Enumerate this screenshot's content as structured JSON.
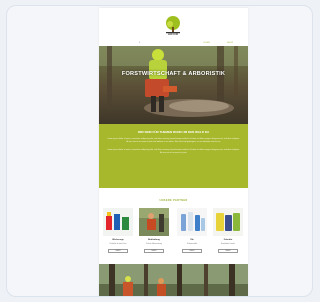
{
  "site": {
    "logo_text": "AIFOR",
    "nav_left": "≡",
    "nav_right": [
      "LOGIN",
      "SHOP"
    ]
  },
  "hero": {
    "title": "FORSTWIRTSCHAFT & ARBORISTIK"
  },
  "intro": {
    "title": "WIR SIND FÜR THEMEN RUND UM DEN WALD DA",
    "body1": "Lorem ipsum dolor sit amet, consetetur sadipscing elitr, sed diam nonumy eirmod tempor invidunt ut labore et dolore magna aliquyam erat, sed diam voluptua. At vero eos et accusam et justo duo dolores et ea rebum. Stet clita kasd gubergren, no sea takimata sanctus est.",
    "body2": "Lorem ipsum dolor sit amet, consetetur sadipscing elitr, sed diam nonumy eirmod tempor invidunt ut labore et dolore magna aliquyam erat, sed diam voluptua. At vero eos et accusam et justo."
  },
  "partners": {
    "title": "UNSERE PARTNER",
    "items": [
      {
        "name": "Werkzeuge",
        "desc": "Produkte für den Forst",
        "button": "MEHR"
      },
      {
        "name": "Bekleidung",
        "desc": "Schutz & Ausrüstung",
        "button": "MEHR"
      },
      {
        "name": "Öle",
        "desc": "Schmierstoffe",
        "button": "MEHR"
      },
      {
        "name": "Zubehör",
        "desc": "Ersatzteile & mehr",
        "button": "MEHR"
      }
    ]
  },
  "colors": {
    "accent": "#a7b82c",
    "background": "#eef1f6"
  }
}
